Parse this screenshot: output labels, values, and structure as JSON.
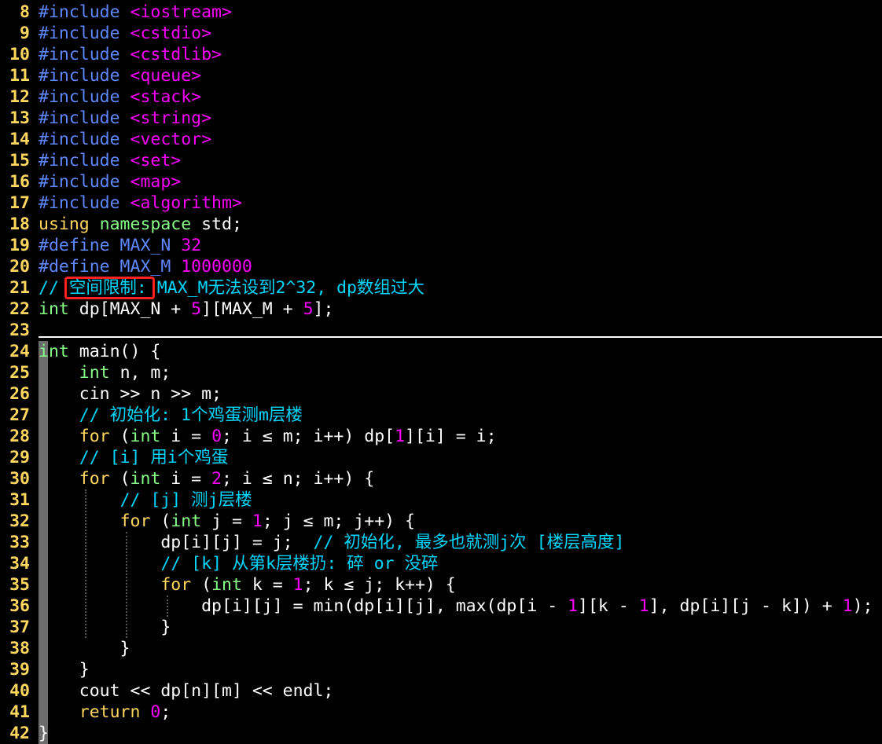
{
  "editor": {
    "colors": {
      "background": "#000000",
      "line_number": "#ffd75f",
      "preprocessor": "#5f87ff",
      "include_path": "#ff00ff",
      "keyword": "#ffd75f",
      "type": "#87ff87",
      "number": "#ff00ff",
      "comment": "#00d7ff",
      "text": "#ffffff",
      "annotation_box": "#ff2020"
    },
    "lines": [
      {
        "num": "8",
        "segs": [
          [
            "pre",
            "#include "
          ],
          [
            "inc",
            "<iostream>"
          ]
        ]
      },
      {
        "num": "9",
        "segs": [
          [
            "pre",
            "#include "
          ],
          [
            "inc",
            "<cstdio>"
          ]
        ]
      },
      {
        "num": "10",
        "segs": [
          [
            "pre",
            "#include "
          ],
          [
            "inc",
            "<cstdlib>"
          ]
        ]
      },
      {
        "num": "11",
        "segs": [
          [
            "pre",
            "#include "
          ],
          [
            "inc",
            "<queue>"
          ]
        ]
      },
      {
        "num": "12",
        "segs": [
          [
            "pre",
            "#include "
          ],
          [
            "inc",
            "<stack>"
          ]
        ]
      },
      {
        "num": "13",
        "segs": [
          [
            "pre",
            "#include "
          ],
          [
            "inc",
            "<string>"
          ]
        ]
      },
      {
        "num": "14",
        "segs": [
          [
            "pre",
            "#include "
          ],
          [
            "inc",
            "<vector>"
          ]
        ]
      },
      {
        "num": "15",
        "segs": [
          [
            "pre",
            "#include "
          ],
          [
            "inc",
            "<set>"
          ]
        ]
      },
      {
        "num": "16",
        "segs": [
          [
            "pre",
            "#include "
          ],
          [
            "inc",
            "<map>"
          ]
        ]
      },
      {
        "num": "17",
        "segs": [
          [
            "pre",
            "#include "
          ],
          [
            "inc",
            "<algorithm>"
          ]
        ]
      },
      {
        "num": "18",
        "segs": [
          [
            "key",
            "using "
          ],
          [
            "type",
            "namespace "
          ],
          [
            "pln",
            "std;"
          ]
        ]
      },
      {
        "num": "19",
        "segs": [
          [
            "pre",
            "#define MAX_N "
          ],
          [
            "num",
            "32"
          ]
        ]
      },
      {
        "num": "20",
        "segs": [
          [
            "pre",
            "#define MAX_M "
          ],
          [
            "num",
            "1000000"
          ]
        ]
      },
      {
        "num": "21",
        "segs": [
          [
            "com",
            "// 空间限制: MAX_M无法设到2^32, dp数组过大"
          ]
        ]
      },
      {
        "num": "22",
        "segs": [
          [
            "type",
            "int "
          ],
          [
            "pln",
            "dp[MAX_N + "
          ],
          [
            "num",
            "5"
          ],
          [
            "pln",
            "][MAX_M + "
          ],
          [
            "num",
            "5"
          ],
          [
            "pln",
            "];"
          ]
        ]
      },
      {
        "num": "23",
        "segs": []
      },
      {
        "num": "24",
        "segs": [
          [
            "type",
            "int "
          ],
          [
            "pln",
            "main() {"
          ]
        ]
      },
      {
        "num": "25",
        "segs": [
          [
            "pln",
            "    "
          ],
          [
            "type",
            "int "
          ],
          [
            "pln",
            "n, m;"
          ]
        ]
      },
      {
        "num": "26",
        "segs": [
          [
            "pln",
            "    cin >> n >> m;"
          ]
        ]
      },
      {
        "num": "27",
        "segs": [
          [
            "pln",
            "    "
          ],
          [
            "com",
            "// 初始化: 1个鸡蛋测m层楼"
          ]
        ]
      },
      {
        "num": "28",
        "segs": [
          [
            "pln",
            "    "
          ],
          [
            "key",
            "for "
          ],
          [
            "pln",
            "("
          ],
          [
            "type",
            "int "
          ],
          [
            "pln",
            "i = "
          ],
          [
            "num",
            "0"
          ],
          [
            "pln",
            "; i ≤ m; i++) dp["
          ],
          [
            "num",
            "1"
          ],
          [
            "pln",
            "][i] = i;"
          ]
        ]
      },
      {
        "num": "29",
        "segs": [
          [
            "pln",
            "    "
          ],
          [
            "com",
            "// [i] 用i个鸡蛋"
          ]
        ]
      },
      {
        "num": "30",
        "segs": [
          [
            "pln",
            "    "
          ],
          [
            "key",
            "for "
          ],
          [
            "pln",
            "("
          ],
          [
            "type",
            "int "
          ],
          [
            "pln",
            "i = "
          ],
          [
            "num",
            "2"
          ],
          [
            "pln",
            "; i ≤ n; i++) {"
          ]
        ]
      },
      {
        "num": "31",
        "segs": [
          [
            "pln",
            "        "
          ],
          [
            "com",
            "// [j] 测j层楼"
          ]
        ]
      },
      {
        "num": "32",
        "segs": [
          [
            "pln",
            "        "
          ],
          [
            "key",
            "for "
          ],
          [
            "pln",
            "("
          ],
          [
            "type",
            "int "
          ],
          [
            "pln",
            "j = "
          ],
          [
            "num",
            "1"
          ],
          [
            "pln",
            "; j ≤ m; j++) {"
          ]
        ]
      },
      {
        "num": "33",
        "segs": [
          [
            "pln",
            "            dp[i][j] = j;  "
          ],
          [
            "com",
            "// 初始化, 最多也就测j次 [楼层高度]"
          ]
        ]
      },
      {
        "num": "34",
        "segs": [
          [
            "pln",
            "            "
          ],
          [
            "com",
            "// [k] 从第k层楼扔: 碎 or 没碎"
          ]
        ]
      },
      {
        "num": "35",
        "segs": [
          [
            "pln",
            "            "
          ],
          [
            "key",
            "for "
          ],
          [
            "pln",
            "("
          ],
          [
            "type",
            "int "
          ],
          [
            "pln",
            "k = "
          ],
          [
            "num",
            "1"
          ],
          [
            "pln",
            "; k ≤ j; k++) {"
          ]
        ]
      },
      {
        "num": "36",
        "segs": [
          [
            "pln",
            "                dp[i][j] = min(dp[i][j], max(dp[i - "
          ],
          [
            "num",
            "1"
          ],
          [
            "pln",
            "][k - "
          ],
          [
            "num",
            "1"
          ],
          [
            "pln",
            "], dp[i][j - k]) + "
          ],
          [
            "num",
            "1"
          ],
          [
            "pln",
            ");"
          ]
        ]
      },
      {
        "num": "37",
        "segs": [
          [
            "pln",
            "            }"
          ]
        ]
      },
      {
        "num": "38",
        "segs": [
          [
            "pln",
            "        }"
          ]
        ]
      },
      {
        "num": "39",
        "segs": [
          [
            "pln",
            "    }"
          ]
        ]
      },
      {
        "num": "40",
        "segs": [
          [
            "pln",
            "    cout << dp[n][m] << endl;"
          ]
        ]
      },
      {
        "num": "41",
        "segs": [
          [
            "pln",
            "    "
          ],
          [
            "key",
            "return "
          ],
          [
            "num",
            "0"
          ],
          [
            "pln",
            ";"
          ]
        ]
      },
      {
        "num": "42",
        "segs": [
          [
            "pln",
            "}"
          ]
        ]
      }
    ]
  }
}
